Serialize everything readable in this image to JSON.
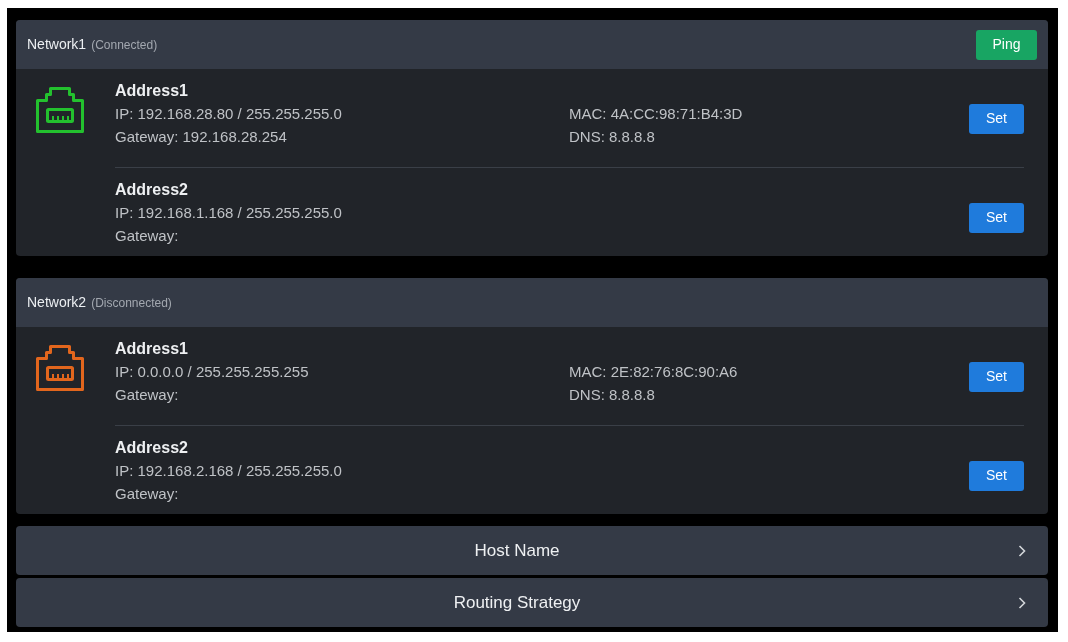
{
  "networks": [
    {
      "name": "Network1",
      "status": "(Connected)",
      "connected": true,
      "ping_button": "Ping",
      "addresses": [
        {
          "title": "Address1",
          "ip": "IP: 192.168.28.80 / 255.255.255.0",
          "gateway": "Gateway: 192.168.28.254",
          "mac": "MAC: 4A:CC:98:71:B4:3D",
          "dns": "DNS: 8.8.8.8",
          "set_button": "Set"
        },
        {
          "title": "Address2",
          "ip": "IP: 192.168.1.168 / 255.255.255.0",
          "gateway": "Gateway:",
          "set_button": "Set"
        }
      ]
    },
    {
      "name": "Network2",
      "status": "(Disconnected)",
      "connected": false,
      "addresses": [
        {
          "title": "Address1",
          "ip": "IP: 0.0.0.0 / 255.255.255.255",
          "gateway": "Gateway:",
          "mac": "MAC: 2E:82:76:8C:90:A6",
          "dns": "DNS: 8.8.8.8",
          "set_button": "Set"
        },
        {
          "title": "Address2",
          "ip": "IP: 192.168.2.168 / 255.255.255.0",
          "gateway": "Gateway:",
          "set_button": "Set"
        }
      ]
    }
  ],
  "settings_rows": [
    {
      "label": "Host Name"
    },
    {
      "label": "Routing Strategy"
    }
  ]
}
